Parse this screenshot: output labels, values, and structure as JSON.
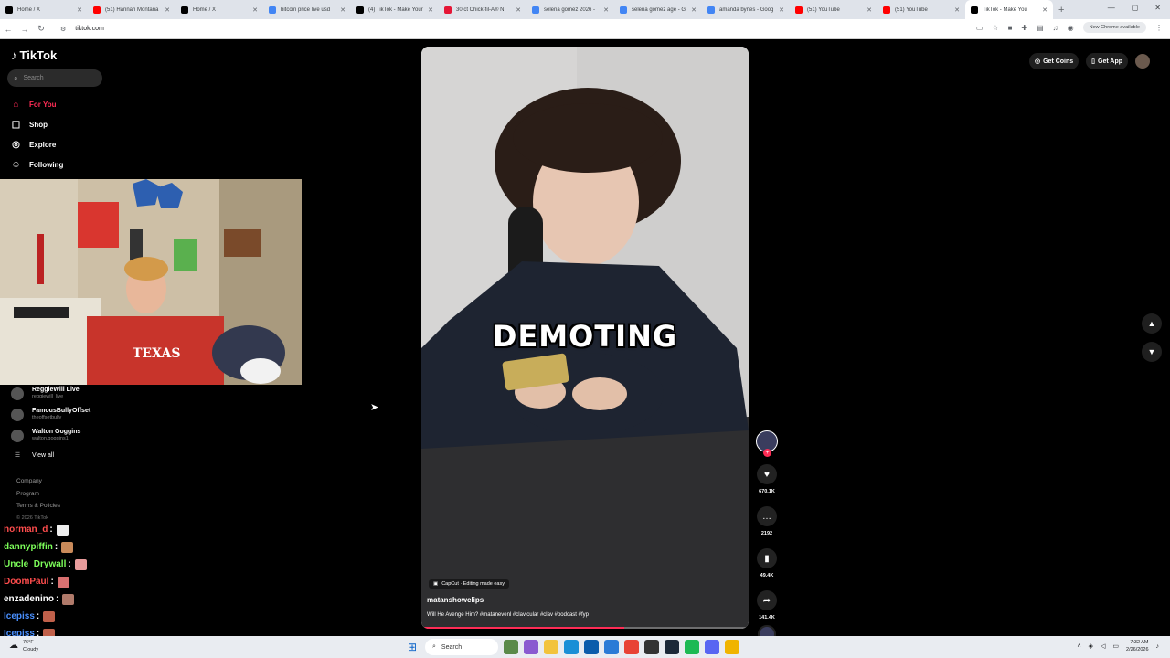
{
  "browser": {
    "tabs": [
      {
        "title": "Home / X",
        "favicon_color": "#000000"
      },
      {
        "title": "(51) Hannah Montana",
        "favicon_color": "#ff0000"
      },
      {
        "title": "Home / X",
        "favicon_color": "#000000"
      },
      {
        "title": "bitcoin price live usd",
        "favicon_color": "#4285f4"
      },
      {
        "title": "(4) TikTok - Make Your",
        "favicon_color": "#000000"
      },
      {
        "title": "30 ct Chick-fil-A® N",
        "favicon_color": "#e51636"
      },
      {
        "title": "selena gomez 2026 -",
        "favicon_color": "#4285f4"
      },
      {
        "title": "selena gomez age - G",
        "favicon_color": "#4285f4"
      },
      {
        "title": "amanda bynes - Goog",
        "favicon_color": "#4285f4"
      },
      {
        "title": "(51) YouTube",
        "favicon_color": "#ff0000"
      },
      {
        "title": "(51) YouTube",
        "favicon_color": "#ff0000"
      },
      {
        "title": "TikTok - Make You",
        "favicon_color": "#000000",
        "active": true
      }
    ],
    "url": "tiktok.com",
    "new_chrome_label": "New Chrome available"
  },
  "tiktok": {
    "logo_text": "TikTok",
    "search_placeholder": "Search",
    "nav": [
      {
        "label": "For You",
        "icon": "home-icon",
        "active": true
      },
      {
        "label": "Shop",
        "icon": "bag-icon"
      },
      {
        "label": "Explore",
        "icon": "compass-icon"
      },
      {
        "label": "Following",
        "icon": "following-icon"
      }
    ],
    "following_accounts": [
      {
        "name": "ReggieWill Live",
        "handle": "reggiewill_live"
      },
      {
        "name": "FamousBullyOffset",
        "handle": "theoffsetbully"
      },
      {
        "name": "Walton Goggins",
        "handle": "walton.goggins1"
      }
    ],
    "view_all_label": "View all",
    "footer": {
      "company": "Company",
      "program": "Program",
      "terms": "Terms & Policies",
      "copyright": "© 2026 TikTok"
    },
    "top_right": {
      "get_coins": "Get Coins",
      "get_app": "Get App"
    },
    "video": {
      "overlay_text": "DEMOTING",
      "capcut_label": "CapCut · Editing made easy",
      "author": "matanshowclips",
      "caption": "Will He Avenge Him? #matanevenl #clavicular #clav #podcast #fyp",
      "progress": 0.62
    },
    "actions": {
      "likes": "670.1K",
      "comments": "2192",
      "saves": "49.4K",
      "shares": "141.4K"
    }
  },
  "stream_chat": [
    {
      "user": "norman_d",
      "color": "#ff4d4d"
    },
    {
      "user": "dannypiffin",
      "color": "#7dff5a"
    },
    {
      "user": "Uncle_Drywall",
      "color": "#7dff5a"
    },
    {
      "user": "DoomPaul",
      "color": "#ff4d4d"
    },
    {
      "user": "enzadenino",
      "color": "#ffffff"
    },
    {
      "user": "Icepiss",
      "color": "#4a90ff"
    },
    {
      "user": "Icepiss",
      "color": "#4a90ff"
    }
  ],
  "taskbar": {
    "weather_temp": "76°F",
    "weather_desc": "Cloudy",
    "search_label": "Search",
    "time": "7:32 AM",
    "date": "2/26/2026"
  }
}
